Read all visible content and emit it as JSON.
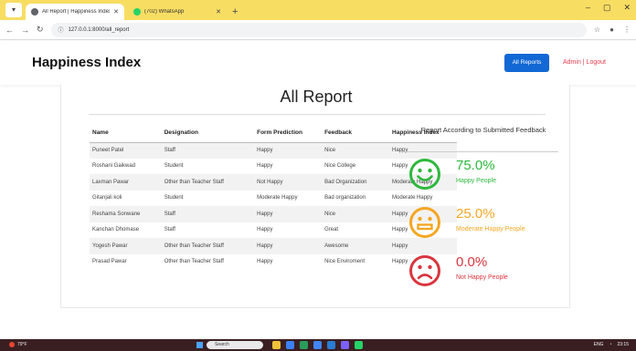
{
  "browser": {
    "tabs": [
      {
        "label": "All Report | Happiness Index",
        "favicon_color": "#5f6368",
        "active": true
      },
      {
        "label": "(702) WhatsApp",
        "favicon_color": "#25d366",
        "active": false
      }
    ],
    "new_tab": "+",
    "url": "127.0.0.1:8000/all_report",
    "window_controls": [
      "–",
      "▢",
      "✕"
    ]
  },
  "nav": {
    "brand": "Happiness Index",
    "reports_button": "All Reports",
    "admin_links": "Admin | Logout"
  },
  "page": {
    "title": "All Report"
  },
  "table": {
    "headers": [
      "Name",
      "Designation",
      "Form Prediction",
      "Feedback",
      "Happiness Index"
    ],
    "rows": [
      [
        "Puneet Patel",
        "Staff",
        "Happy",
        "Nice",
        "Happy"
      ],
      [
        "Roshani Gaikwad",
        "Student",
        "Happy",
        "Nice College",
        "Happy"
      ],
      [
        "Laxman Pawar",
        "Other than Teacher Staff",
        "Not Happy",
        "Bad Organization",
        "Moderate Happy"
      ],
      [
        "Gitanjali koli",
        "Student",
        "Moderate Happy",
        "Bad organization",
        "Moderate Happy"
      ],
      [
        "Reshama Sonwane",
        "Staff",
        "Happy",
        "Nice",
        "Happy"
      ],
      [
        "Kanchan Dhomase",
        "Staff",
        "Happy",
        "Great",
        "Happy"
      ],
      [
        "Yogesh Pawar",
        "Other than Teacher Staff",
        "Happy",
        "Awesome",
        "Happy"
      ],
      [
        "Prasad Pawar",
        "Other than Teacher Staff",
        "Happy",
        "Nice Enviroment",
        "Happy"
      ]
    ]
  },
  "summary": {
    "title": "Report According to Submitted Feedback",
    "stats": [
      {
        "percent": "75.0%",
        "label": "Happy People",
        "color": "#2db83d",
        "icon": "happy-face-icon",
        "mood": "happy"
      },
      {
        "percent": "25.0%",
        "label": "Moderate Happy People",
        "color": "#f5a623",
        "icon": "neutral-face-icon",
        "mood": "neutral"
      },
      {
        "percent": "0.0%",
        "label": "Not Happy People",
        "color": "#d9363e",
        "icon": "sad-face-icon",
        "mood": "sad"
      }
    ]
  },
  "taskbar": {
    "weather": "79°F",
    "search_placeholder": "Search",
    "language": "ENG",
    "clock": "23:15"
  }
}
